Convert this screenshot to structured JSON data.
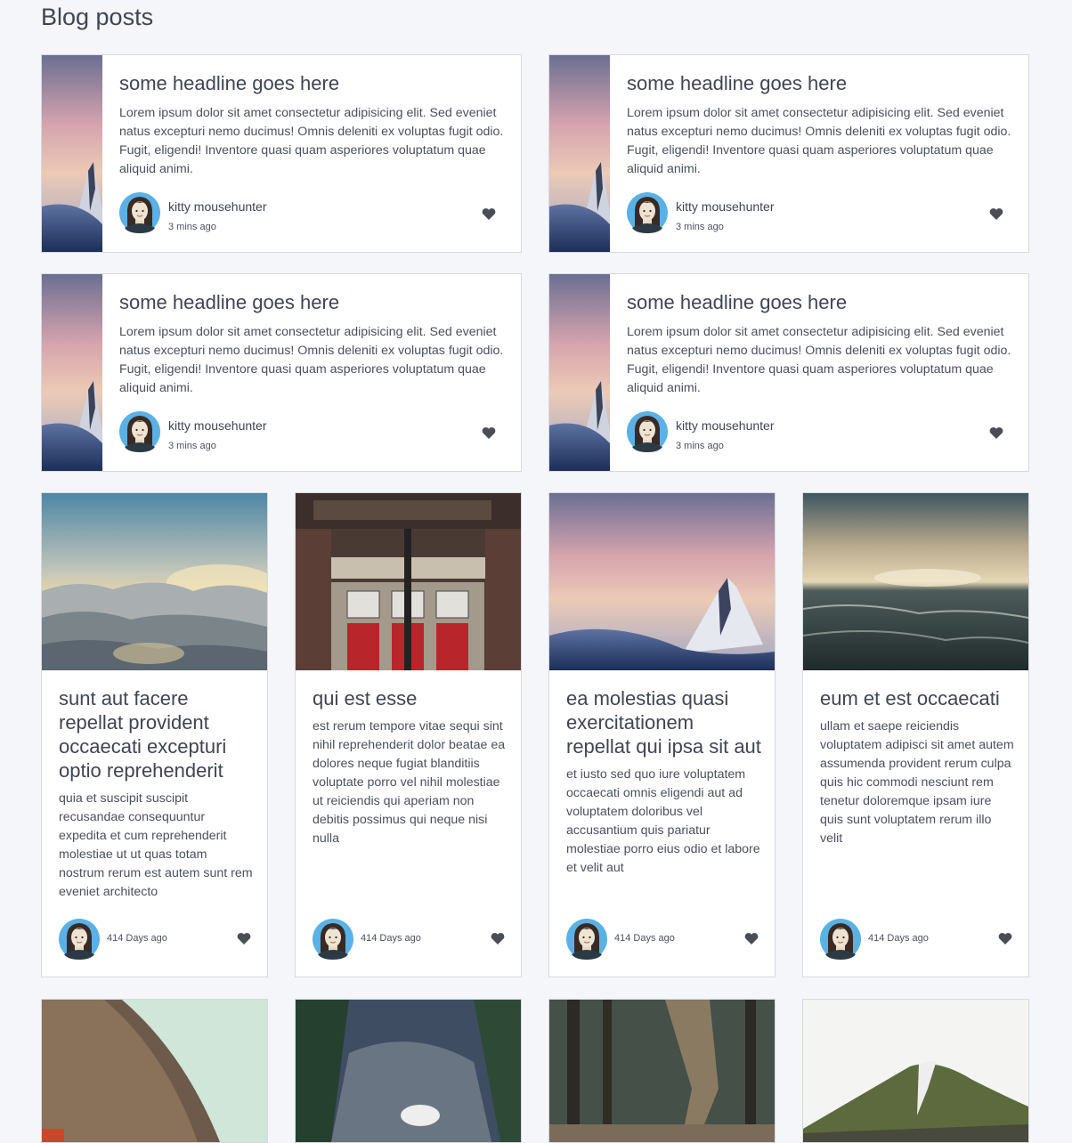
{
  "page": {
    "title": "Blog posts"
  },
  "featured_posts": [
    {
      "headline": "some headline goes here",
      "excerpt": "Lorem ipsum dolor sit amet consectetur adipisicing elit. Sed eveniet natus excepturi nemo ducimus! Omnis deleniti ex voluptas fugit odio. Fugit, eligendi! Inventore quasi quam asperiores voluptatum quae aliquid animi.",
      "author": "kitty mousehunter",
      "time": "3 mins ago",
      "icon": "heart-icon"
    },
    {
      "headline": "some headline goes here",
      "excerpt": "Lorem ipsum dolor sit amet consectetur adipisicing elit. Sed eveniet natus excepturi nemo ducimus! Omnis deleniti ex voluptas fugit odio. Fugit, eligendi! Inventore quasi quam asperiores voluptatum quae aliquid animi.",
      "author": "kitty mousehunter",
      "time": "3 mins ago",
      "icon": "heart-icon"
    },
    {
      "headline": "some headline goes here",
      "excerpt": "Lorem ipsum dolor sit amet consectetur adipisicing elit. Sed eveniet natus excepturi nemo ducimus! Omnis deleniti ex voluptas fugit odio. Fugit, eligendi! Inventore quasi quam asperiores voluptatum quae aliquid animi.",
      "author": "kitty mousehunter",
      "time": "3 mins ago",
      "icon": "heart-icon"
    },
    {
      "headline": "some headline goes here",
      "excerpt": "Lorem ipsum dolor sit amet consectetur adipisicing elit. Sed eveniet natus excepturi nemo ducimus! Omnis deleniti ex voluptas fugit odio. Fugit, eligendi! Inventore quasi quam asperiores voluptatum quae aliquid animi.",
      "author": "kitty mousehunter",
      "time": "3 mins ago",
      "icon": "heart-icon"
    }
  ],
  "grid_posts": [
    {
      "headline": "sunt aut facere repellat provident occaecati excepturi optio reprehenderit",
      "excerpt": "quia et suscipit suscipit recusandae consequuntur expedita et cum reprehenderit molestiae ut ut quas totam nostrum rerum est autem sunt rem eveniet architecto",
      "time": "414 Days ago",
      "image": "clouds-sunset"
    },
    {
      "headline": "qui est esse",
      "excerpt": "est rerum tempore vitae sequi sint nihil reprehenderit dolor beatae ea dolores neque fugiat blanditiis voluptate porro vel nihil molestiae ut reiciendis qui aperiam non debitis possimus qui neque nisi nulla",
      "time": "414 Days ago",
      "image": "massey-hall"
    },
    {
      "headline": "ea molestias quasi exercitationem repellat qui ipsa sit aut",
      "excerpt": "et iusto sed quo iure voluptatem occaecati omnis eligendi aut ad voluptatem doloribus vel accusantium quis pariatur molestiae porro eius odio et labore et velit aut",
      "time": "414 Days ago",
      "image": "mountain-peak"
    },
    {
      "headline": "eum et est occaecati",
      "excerpt": "ullam et saepe reiciendis voluptatem adipisci sit amet autem assumenda provident rerum culpa quis hic commodi nesciunt rem tenetur doloremque ipsam iure quis sunt voluptatem rerum illo velit",
      "time": "414 Days ago",
      "image": "sea-storm"
    }
  ],
  "more_posts": [
    {
      "image": "curved-building"
    },
    {
      "image": "mountain-goat"
    },
    {
      "image": "forest-hiker"
    },
    {
      "image": "green-hill"
    }
  ]
}
